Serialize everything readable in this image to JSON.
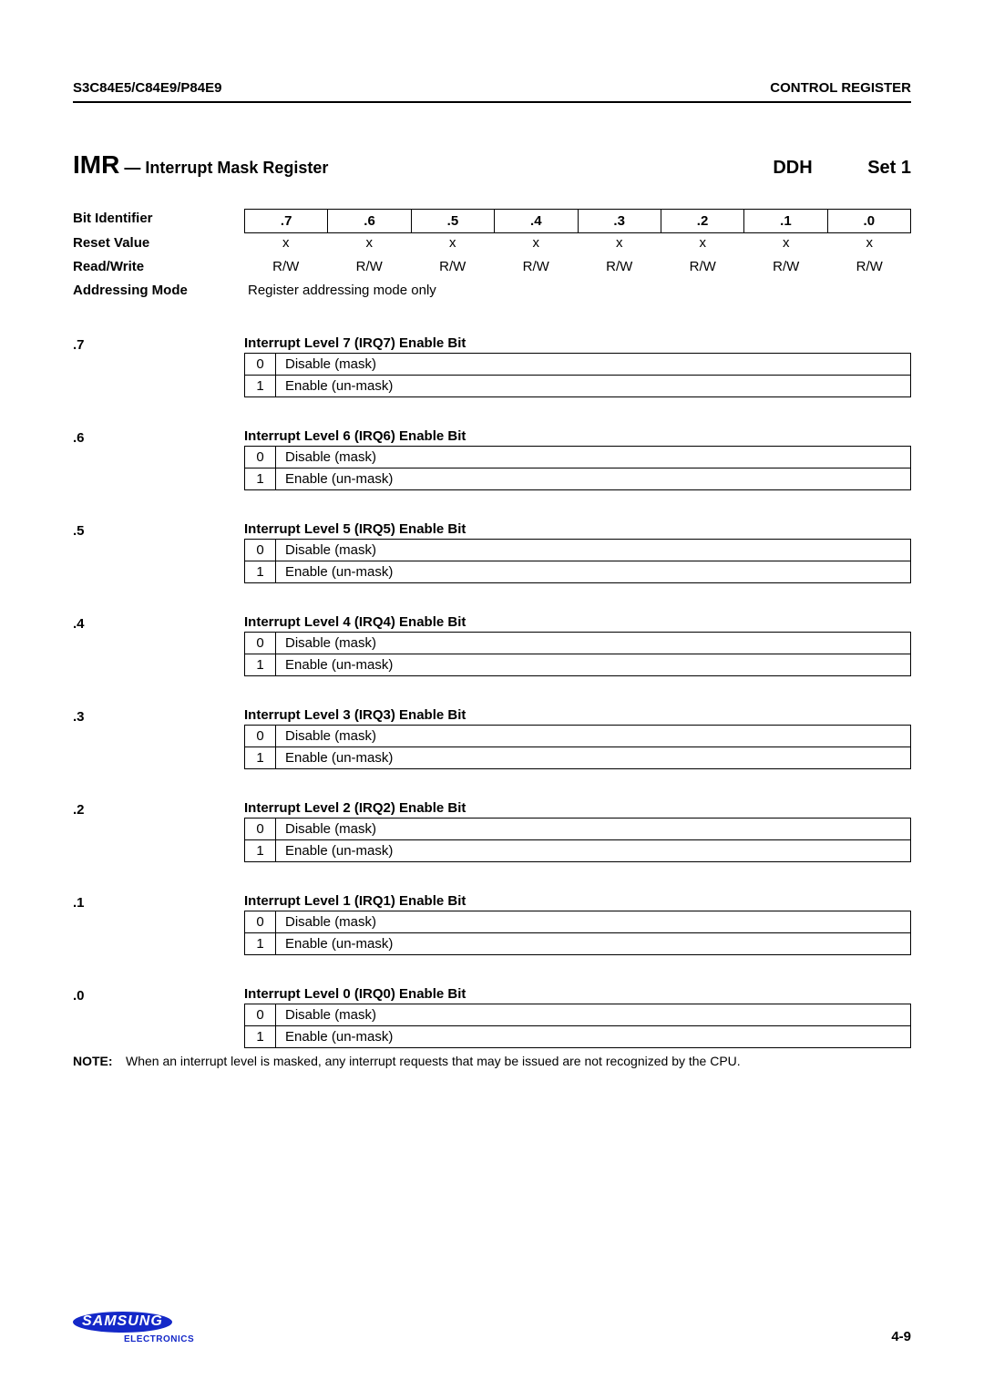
{
  "header": {
    "left": "S3C84E5/C84E9/P84E9",
    "right": "CONTROL REGISTER"
  },
  "title": {
    "reg_abbr": "IMR",
    "reg_name": " — Interrupt Mask Register",
    "addr": "DDH",
    "set": "Set 1"
  },
  "summary": {
    "rows": [
      {
        "label": "Bit Identifier",
        "type": "boxed",
        "cells": [
          ".7",
          ".6",
          ".5",
          ".4",
          ".3",
          ".2",
          ".1",
          ".0"
        ]
      },
      {
        "label": "Reset Value",
        "type": "plain",
        "cells": [
          "x",
          "x",
          "x",
          "x",
          "x",
          "x",
          "x",
          "x"
        ]
      },
      {
        "label": "Read/Write",
        "type": "plain",
        "cells": [
          "R/W",
          "R/W",
          "R/W",
          "R/W",
          "R/W",
          "R/W",
          "R/W",
          "R/W"
        ]
      },
      {
        "label": "Addressing Mode",
        "type": "text",
        "text": "Register addressing mode only"
      }
    ]
  },
  "bits": [
    {
      "bit": ".7",
      "title": "Interrupt Level 7 (IRQ7) Enable Bit",
      "opts": [
        {
          "v": "0",
          "d": "Disable (mask)"
        },
        {
          "v": "1",
          "d": "Enable (un-mask)"
        }
      ]
    },
    {
      "bit": ".6",
      "title": "Interrupt Level 6 (IRQ6) Enable Bit",
      "opts": [
        {
          "v": "0",
          "d": "Disable (mask)"
        },
        {
          "v": "1",
          "d": "Enable (un-mask)"
        }
      ]
    },
    {
      "bit": ".5",
      "title": "Interrupt Level 5 (IRQ5) Enable Bit",
      "opts": [
        {
          "v": "0",
          "d": "Disable (mask)"
        },
        {
          "v": "1",
          "d": "Enable (un-mask)"
        }
      ]
    },
    {
      "bit": ".4",
      "title": "Interrupt Level 4 (IRQ4) Enable Bit",
      "opts": [
        {
          "v": "0",
          "d": "Disable (mask)"
        },
        {
          "v": "1",
          "d": "Enable (un-mask)"
        }
      ]
    },
    {
      "bit": ".3",
      "title": "Interrupt Level 3 (IRQ3) Enable Bit",
      "opts": [
        {
          "v": "0",
          "d": "Disable (mask)"
        },
        {
          "v": "1",
          "d": "Enable (un-mask)"
        }
      ]
    },
    {
      "bit": ".2",
      "title": "Interrupt Level 2 (IRQ2) Enable Bit",
      "opts": [
        {
          "v": "0",
          "d": "Disable (mask)"
        },
        {
          "v": "1",
          "d": "Enable (un-mask)"
        }
      ]
    },
    {
      "bit": ".1",
      "title": "Interrupt Level 1 (IRQ1) Enable Bit",
      "opts": [
        {
          "v": "0",
          "d": "Disable (mask)"
        },
        {
          "v": "1",
          "d": "Enable (un-mask)"
        }
      ]
    },
    {
      "bit": ".0",
      "title": "Interrupt Level 0 (IRQ0) Enable Bit",
      "opts": [
        {
          "v": "0",
          "d": "Disable (mask)"
        },
        {
          "v": "1",
          "d": "Enable (un-mask)"
        }
      ]
    }
  ],
  "note": {
    "label": "NOTE:",
    "text": "When an interrupt level is masked, any interrupt requests that may be issued are not recognized by the CPU."
  },
  "footer": {
    "brand": "SAMSUNG",
    "sub": "ELECTRONICS",
    "page": "4-9"
  }
}
